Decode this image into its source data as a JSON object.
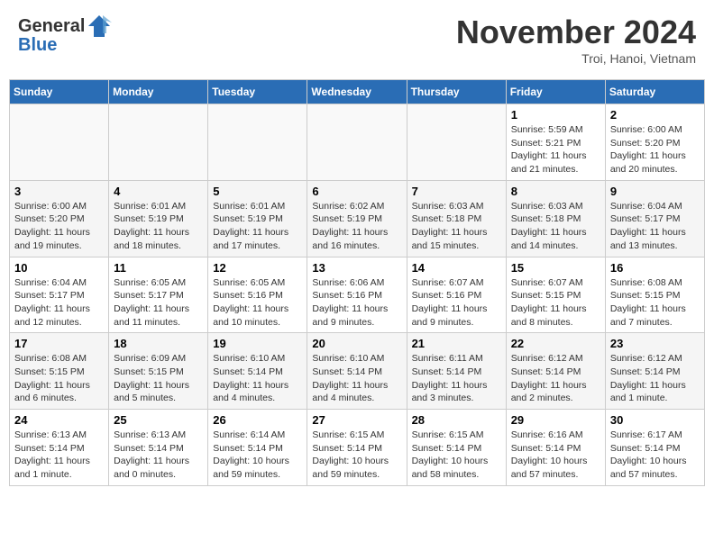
{
  "header": {
    "logo_text_general": "General",
    "logo_text_blue": "Blue",
    "month_title": "November 2024",
    "subtitle": "Troi, Hanoi, Vietnam"
  },
  "days_of_week": [
    "Sunday",
    "Monday",
    "Tuesday",
    "Wednesday",
    "Thursday",
    "Friday",
    "Saturday"
  ],
  "weeks": [
    [
      {
        "day": "",
        "info": ""
      },
      {
        "day": "",
        "info": ""
      },
      {
        "day": "",
        "info": ""
      },
      {
        "day": "",
        "info": ""
      },
      {
        "day": "",
        "info": ""
      },
      {
        "day": "1",
        "info": "Sunrise: 5:59 AM\nSunset: 5:21 PM\nDaylight: 11 hours and 21 minutes."
      },
      {
        "day": "2",
        "info": "Sunrise: 6:00 AM\nSunset: 5:20 PM\nDaylight: 11 hours and 20 minutes."
      }
    ],
    [
      {
        "day": "3",
        "info": "Sunrise: 6:00 AM\nSunset: 5:20 PM\nDaylight: 11 hours and 19 minutes."
      },
      {
        "day": "4",
        "info": "Sunrise: 6:01 AM\nSunset: 5:19 PM\nDaylight: 11 hours and 18 minutes."
      },
      {
        "day": "5",
        "info": "Sunrise: 6:01 AM\nSunset: 5:19 PM\nDaylight: 11 hours and 17 minutes."
      },
      {
        "day": "6",
        "info": "Sunrise: 6:02 AM\nSunset: 5:19 PM\nDaylight: 11 hours and 16 minutes."
      },
      {
        "day": "7",
        "info": "Sunrise: 6:03 AM\nSunset: 5:18 PM\nDaylight: 11 hours and 15 minutes."
      },
      {
        "day": "8",
        "info": "Sunrise: 6:03 AM\nSunset: 5:18 PM\nDaylight: 11 hours and 14 minutes."
      },
      {
        "day": "9",
        "info": "Sunrise: 6:04 AM\nSunset: 5:17 PM\nDaylight: 11 hours and 13 minutes."
      }
    ],
    [
      {
        "day": "10",
        "info": "Sunrise: 6:04 AM\nSunset: 5:17 PM\nDaylight: 11 hours and 12 minutes."
      },
      {
        "day": "11",
        "info": "Sunrise: 6:05 AM\nSunset: 5:17 PM\nDaylight: 11 hours and 11 minutes."
      },
      {
        "day": "12",
        "info": "Sunrise: 6:05 AM\nSunset: 5:16 PM\nDaylight: 11 hours and 10 minutes."
      },
      {
        "day": "13",
        "info": "Sunrise: 6:06 AM\nSunset: 5:16 PM\nDaylight: 11 hours and 9 minutes."
      },
      {
        "day": "14",
        "info": "Sunrise: 6:07 AM\nSunset: 5:16 PM\nDaylight: 11 hours and 9 minutes."
      },
      {
        "day": "15",
        "info": "Sunrise: 6:07 AM\nSunset: 5:15 PM\nDaylight: 11 hours and 8 minutes."
      },
      {
        "day": "16",
        "info": "Sunrise: 6:08 AM\nSunset: 5:15 PM\nDaylight: 11 hours and 7 minutes."
      }
    ],
    [
      {
        "day": "17",
        "info": "Sunrise: 6:08 AM\nSunset: 5:15 PM\nDaylight: 11 hours and 6 minutes."
      },
      {
        "day": "18",
        "info": "Sunrise: 6:09 AM\nSunset: 5:15 PM\nDaylight: 11 hours and 5 minutes."
      },
      {
        "day": "19",
        "info": "Sunrise: 6:10 AM\nSunset: 5:14 PM\nDaylight: 11 hours and 4 minutes."
      },
      {
        "day": "20",
        "info": "Sunrise: 6:10 AM\nSunset: 5:14 PM\nDaylight: 11 hours and 4 minutes."
      },
      {
        "day": "21",
        "info": "Sunrise: 6:11 AM\nSunset: 5:14 PM\nDaylight: 11 hours and 3 minutes."
      },
      {
        "day": "22",
        "info": "Sunrise: 6:12 AM\nSunset: 5:14 PM\nDaylight: 11 hours and 2 minutes."
      },
      {
        "day": "23",
        "info": "Sunrise: 6:12 AM\nSunset: 5:14 PM\nDaylight: 11 hours and 1 minute."
      }
    ],
    [
      {
        "day": "24",
        "info": "Sunrise: 6:13 AM\nSunset: 5:14 PM\nDaylight: 11 hours and 1 minute."
      },
      {
        "day": "25",
        "info": "Sunrise: 6:13 AM\nSunset: 5:14 PM\nDaylight: 11 hours and 0 minutes."
      },
      {
        "day": "26",
        "info": "Sunrise: 6:14 AM\nSunset: 5:14 PM\nDaylight: 10 hours and 59 minutes."
      },
      {
        "day": "27",
        "info": "Sunrise: 6:15 AM\nSunset: 5:14 PM\nDaylight: 10 hours and 59 minutes."
      },
      {
        "day": "28",
        "info": "Sunrise: 6:15 AM\nSunset: 5:14 PM\nDaylight: 10 hours and 58 minutes."
      },
      {
        "day": "29",
        "info": "Sunrise: 6:16 AM\nSunset: 5:14 PM\nDaylight: 10 hours and 57 minutes."
      },
      {
        "day": "30",
        "info": "Sunrise: 6:17 AM\nSunset: 5:14 PM\nDaylight: 10 hours and 57 minutes."
      }
    ]
  ]
}
